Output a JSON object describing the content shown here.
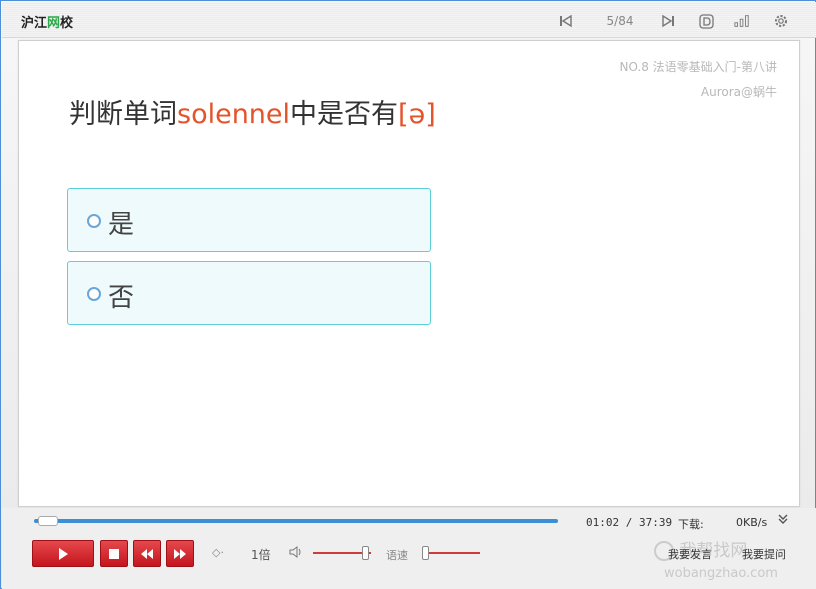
{
  "brand": {
    "logo_main": "沪江",
    "logo_accent": "网",
    "logo_end": "校"
  },
  "toolbar": {
    "page_indicator": "5/84",
    "icons": [
      "skip-back-icon",
      "skip-forward-icon",
      "d-icon",
      "signal-bars-icon",
      "gear-icon"
    ]
  },
  "course": {
    "title": "NO.8 法语零基础入门-第八讲",
    "teacher": "Aurora@蜗牛"
  },
  "question": {
    "prefix": "判断单词",
    "word": "solennel",
    "middle": "中是否有",
    "symbol": "[ə]"
  },
  "options": [
    {
      "label": "是"
    },
    {
      "label": "否"
    }
  ],
  "player": {
    "progress_fraction": 0.0276,
    "elapsed": "01:02",
    "separator": " / ",
    "total": "37:39",
    "download_label": "下载:",
    "download_speed": "0KB/s",
    "speed_label": "1倍",
    "rate_label": "语速",
    "volume_level": 0.9,
    "rate_level": 0.05,
    "speak_button": "我要发言",
    "ask_button": "我要提问"
  },
  "watermark": {
    "site_cn": "我帮找网",
    "site_url": "wobangzhao.com"
  },
  "colors": {
    "accent_red": "#e4532a",
    "brand_green": "#2aa84a",
    "option_bg": "#eefafc",
    "option_border": "#5ccfd9",
    "progress_blue": "#3b8fd6",
    "button_red": "#c5151d"
  }
}
